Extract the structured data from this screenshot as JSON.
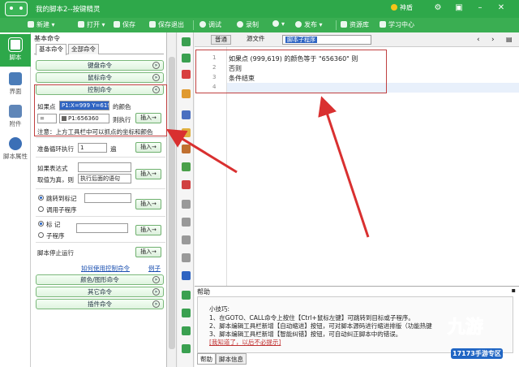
{
  "window": {
    "title": "我的脚本2--按键精灵",
    "vip_label": "神盾"
  },
  "toolbar": {
    "items": [
      "新建",
      "打开",
      "保存",
      "保存退出",
      "调试",
      "录制",
      "发布",
      "资源库",
      "学习中心"
    ]
  },
  "leftnav": {
    "items": [
      "脚本",
      "界面",
      "附件",
      "脚本属性"
    ]
  },
  "commands": {
    "header": "基本命令",
    "tabs": [
      "基本命令",
      "全部命令"
    ],
    "groups": {
      "keyboard": "键盘命令",
      "mouse": "鼠标命令",
      "control": "控制命令",
      "color": "颜色/图形命令",
      "other": "其它命令",
      "plugin": "插件命令"
    },
    "ifpoint": {
      "label": "如果点",
      "point_value": "P1:X=999 Y=619",
      "color_suffix": "的颜色",
      "color_select": "=",
      "color_value": "P1:656360",
      "then_label": "则执行",
      "insert": "插入→"
    },
    "note": "注意：上方工具栏中可以抓点的坐标和颜色",
    "loop": {
      "label": "准备循环执行",
      "count": "1",
      "unit": "遍",
      "insert": "插入→"
    },
    "ifexpr": {
      "label": "如果表达式",
      "cond_label": "取值为真，则",
      "action": "执行后面的语句",
      "insert": "插入→"
    },
    "jump": {
      "opt1": "跳转到标记",
      "opt2": "调用子程序",
      "insert": "插入→"
    },
    "mark": {
      "opt1": "标 记",
      "opt2": "子程序",
      "insert": "插入→"
    },
    "stop": {
      "label": "脚本停止运行",
      "insert": "插入→"
    },
    "howto": "如何使用控制命令",
    "example": "例子"
  },
  "editor": {
    "tabs": [
      "普通",
      "源文件"
    ],
    "selected_command": "脚本子程序",
    "line_numbers": [
      "1",
      "2",
      "3",
      "4"
    ],
    "lines": [
      "如果点 (999,619) 的颜色等于 \"656360\" 则",
      "否则",
      "条件结束",
      ""
    ]
  },
  "help": {
    "header": "帮助",
    "lines": [
      "小技巧:",
      "1、在GOTO、CALL命令上按住【Ctrl+鼠标左键】可跳转到目标或子程序。",
      "2、脚本编辑工具栏新增【自动缩进】按钮，可对脚本源码进行缩进排版（功能热键",
      "3、脚本编辑工具栏新增【智能纠错】按钮，可自动纠正脚本中的错误。",
      "[我知道了，以后不必提示]"
    ],
    "tabs": [
      "帮助",
      "脚本信息"
    ]
  },
  "brand": {
    "name": "九游",
    "site": "17173手游专区"
  },
  "colors": {
    "green": "#2ea84a",
    "red_annotation": "#d93030"
  }
}
